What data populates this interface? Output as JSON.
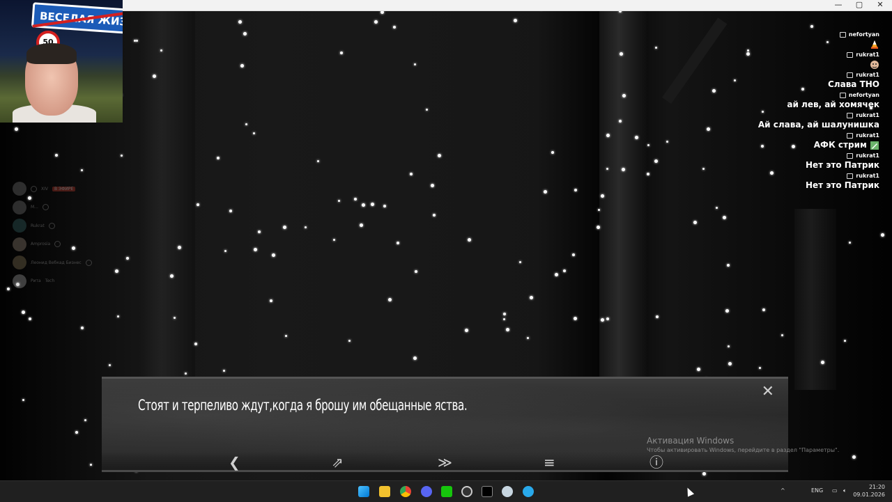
{
  "window": {
    "controls": {
      "minimize": "—",
      "maximize": "▢",
      "close": "✕"
    }
  },
  "webcam": {
    "sign_text": "ВЕСЕЛАЯ ЖИЗНЬ",
    "speed_limit": "50"
  },
  "voice_panel": {
    "users": [
      {
        "name": "XIV",
        "status": "В ЭФИРЕ"
      },
      {
        "name": "M..."
      },
      {
        "name": "Rukrat"
      },
      {
        "name": "Amprosia"
      },
      {
        "name": "Леонид Вебкад Бизнес"
      },
      {
        "name": "Рита",
        "tag": "Tech"
      }
    ]
  },
  "chat": {
    "messages": [
      {
        "user": "nefortyan",
        "text": "",
        "emote": "candy-corn"
      },
      {
        "user": "rukrat1",
        "text": "",
        "emote": "face"
      },
      {
        "user": "rukrat1",
        "text": "Слава ТНО"
      },
      {
        "user": "nefortyan",
        "text": "ай лев, ай хомячек"
      },
      {
        "user": "rukrat1",
        "text": "Ай слава, ай шалунишка"
      },
      {
        "user": "rukrat1",
        "text": "АФК стрим",
        "emote": "pencil"
      },
      {
        "user": "rukrat1",
        "text": "Нет это Патрик"
      },
      {
        "user": "rukrat1",
        "text": "Нет это Патрик"
      }
    ]
  },
  "dialog": {
    "text": "Стоят и терпеливо ждут,когда я брошу им обещанные яства.",
    "close": "✕",
    "controls": {
      "back": "❮",
      "skip": "⇗",
      "fast_forward": "≫",
      "menu": "≡",
      "info": "ⓘ"
    }
  },
  "watermark": {
    "title": "Активация Windows",
    "subtitle": "Чтобы активировать Windows, перейдите в раздел \"Параметры\"."
  },
  "taskbar": {
    "language": "ENG",
    "time": "21:20",
    "date": "09.01.2026",
    "apps": [
      "windows-start",
      "file-explorer",
      "chrome",
      "discord",
      "terminal",
      "obs",
      "capcut",
      "steam",
      "telegram"
    ]
  }
}
